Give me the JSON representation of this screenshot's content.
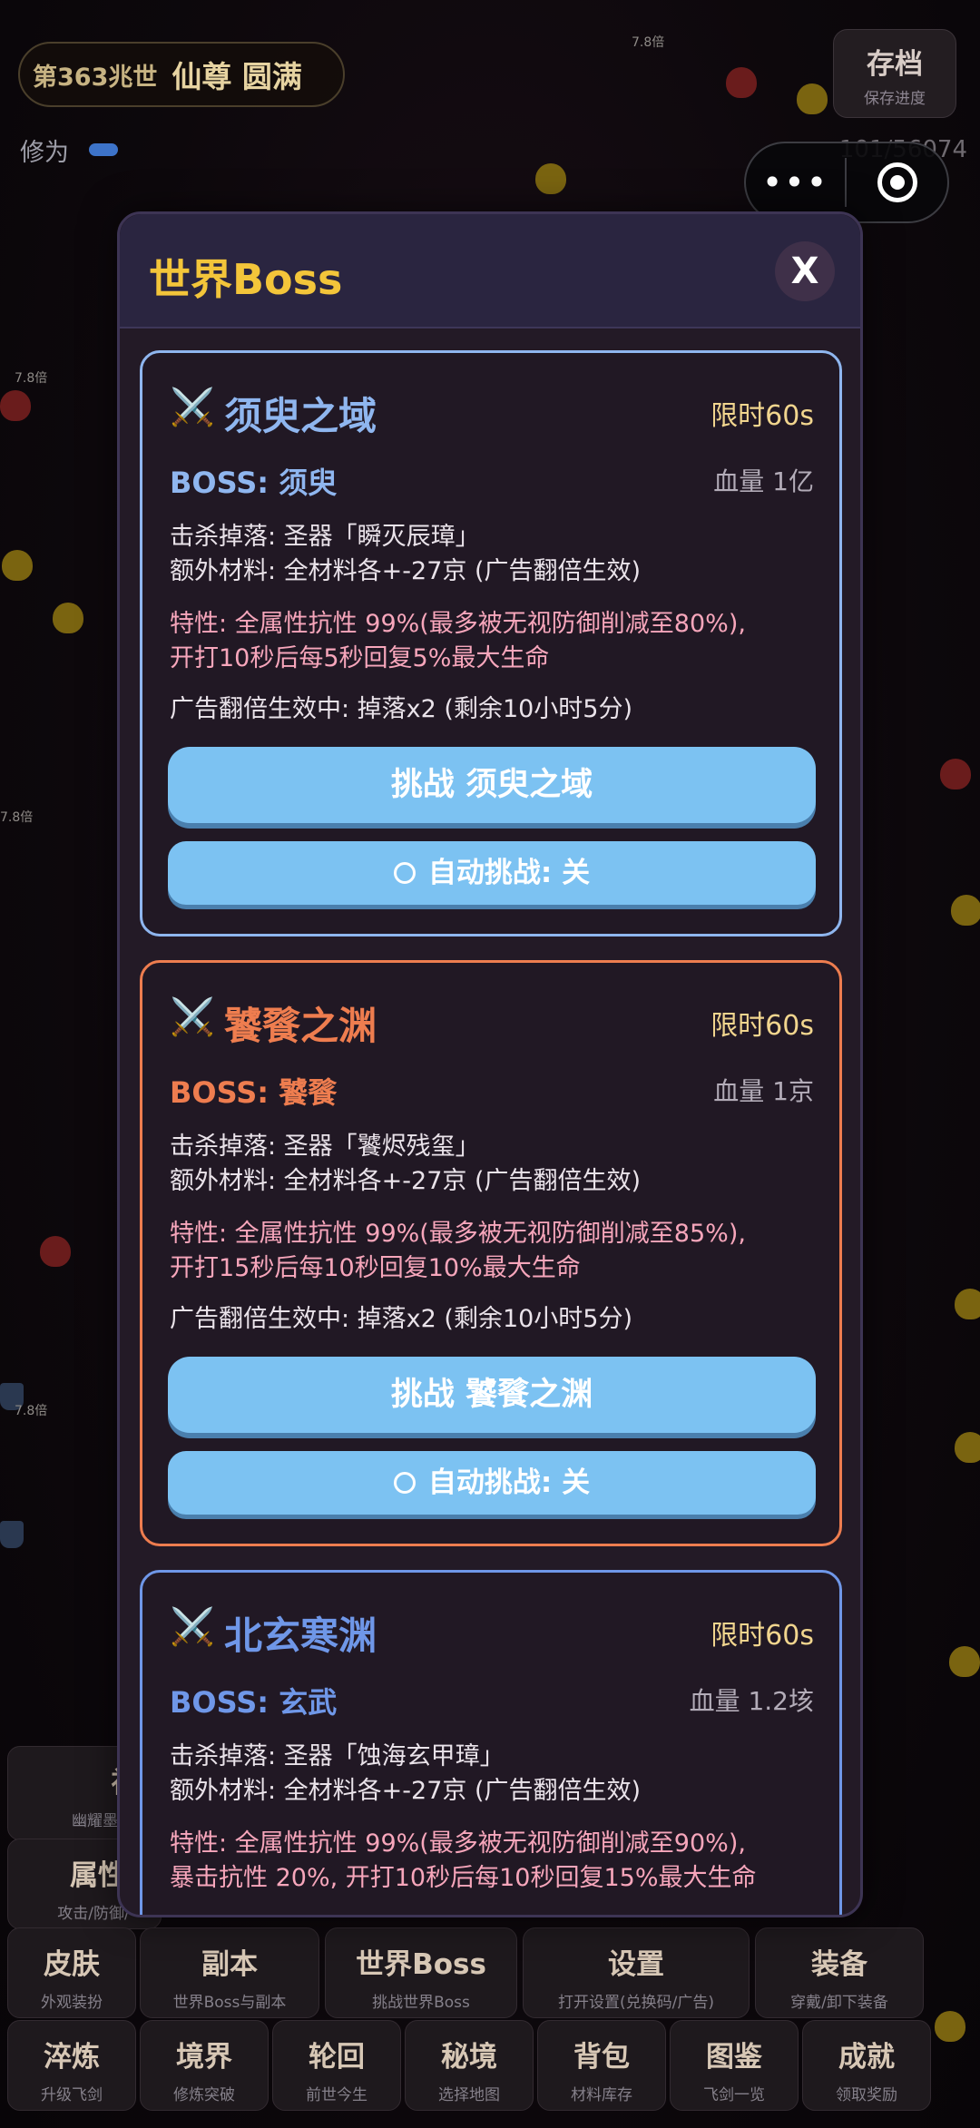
{
  "header": {
    "generation": "第363兆世",
    "stage": "仙尊 圆满",
    "cultivation_label": "修为",
    "cultivation_value": "101/56074",
    "save_label": "存档",
    "save_sub": "保存进度",
    "multiplier_tag": "7.8倍"
  },
  "modal": {
    "title": "世界Boss",
    "close_label": "X",
    "cards": [
      {
        "icon": "⚔️",
        "name": "须臾之域",
        "time_limit": "限时60s",
        "boss": "BOSS: 须臾",
        "hp": "血量 1亿",
        "drop": "击杀掉落: 圣器「瞬灭辰璋」",
        "extra": "额外材料: 全材料各+-27京 (广告翻倍生效)",
        "trait1": "特性: 全属性抗性 99%(最多被无视防御削减至80%),",
        "trait2": "开打10秒后每5秒回复5%最大生命",
        "ad": "广告翻倍生效中: 掉落x2 (剩余10小时5分)",
        "challenge": "挑战 须臾之域",
        "auto": "自动挑战: 关",
        "accent": "#8fb6ef"
      },
      {
        "icon": "⚔️",
        "name": "饕餮之渊",
        "time_limit": "限时60s",
        "boss": "BOSS: 饕餮",
        "hp": "血量 1京",
        "drop": "击杀掉落: 圣器「饕烬残玺」",
        "extra": "额外材料: 全材料各+-27京 (广告翻倍生效)",
        "trait1": "特性: 全属性抗性 99%(最多被无视防御削减至85%),",
        "trait2": "开打15秒后每10秒回复10%最大生命",
        "ad": "广告翻倍生效中: 掉落x2 (剩余10小时5分)",
        "challenge": "挑战 饕餮之渊",
        "auto": "自动挑战: 关",
        "accent": "#ee7d4f"
      },
      {
        "icon": "⚔️",
        "name": "北玄寒渊",
        "time_limit": "限时60s",
        "boss": "BOSS: 玄武",
        "hp": "血量 1.2垓",
        "drop": "击杀掉落: 圣器「蚀海玄甲璋」",
        "extra": "额外材料: 全材料各+-27京 (广告翻倍生效)",
        "trait1": "特性: 全属性抗性 99%(最多被无视防御削减至90%),",
        "trait2": "暴击抗性 20%, 开打10秒后每10秒回复15%最大生命",
        "ad": "",
        "challenge": "",
        "auto": "",
        "accent": "#6f97e8"
      }
    ]
  },
  "menu": {
    "row0": [
      {
        "label": "神",
        "sub": "幽耀墨天"
      },
      {
        "label": "属性",
        "sub": "攻击/防御/"
      }
    ],
    "row1": [
      {
        "label": "皮肤",
        "sub": "外观装扮"
      },
      {
        "label": "副本",
        "sub": "世界Boss与副本"
      },
      {
        "label": "世界Boss",
        "sub": "挑战世界Boss"
      },
      {
        "label": "设置",
        "sub": "打开设置(兑换码/广告)"
      },
      {
        "label": "装备",
        "sub": "穿戴/卸下装备"
      }
    ],
    "row2": [
      {
        "label": "淬炼",
        "sub": "升级飞剑"
      },
      {
        "label": "境界",
        "sub": "修炼突破"
      },
      {
        "label": "轮回",
        "sub": "前世今生"
      },
      {
        "label": "秘境",
        "sub": "选择地图"
      },
      {
        "label": "背包",
        "sub": "材料库存"
      },
      {
        "label": "图鉴",
        "sub": "飞剑一览"
      },
      {
        "label": "成就",
        "sub": "领取奖励"
      }
    ]
  },
  "colors": {
    "title": "#f3c53a",
    "button": "#7cc2f2",
    "trait": "#f7a6bb",
    "time": "#f1d58e"
  }
}
